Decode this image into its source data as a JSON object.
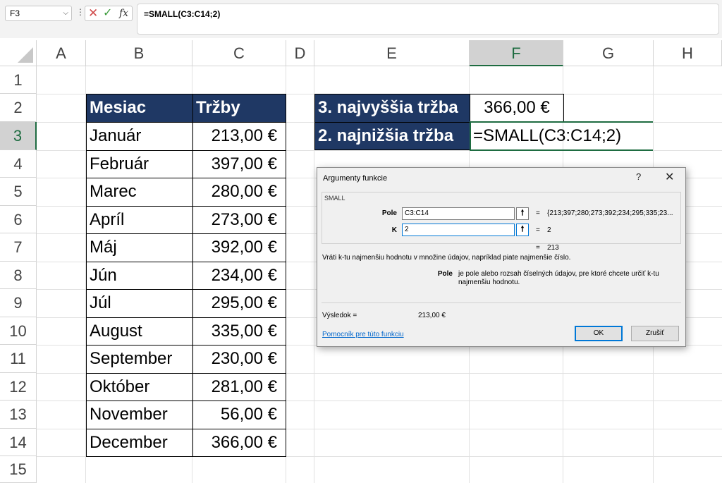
{
  "formula_bar": {
    "name_box": "F3",
    "separator": "⋮",
    "cancel_icon": "✕",
    "enter_icon": "✓",
    "fx_label": "fx",
    "formula": "=SMALL(C3:C14;2)"
  },
  "columns": [
    "A",
    "B",
    "C",
    "D",
    "E",
    "F",
    "G",
    "H"
  ],
  "rows": [
    "1",
    "2",
    "3",
    "4",
    "5",
    "6",
    "7",
    "8",
    "9",
    "10",
    "11",
    "12",
    "13",
    "14",
    "15"
  ],
  "table": {
    "header": [
      "Mesiac",
      "Tržby"
    ],
    "rows": [
      [
        "Január",
        "213,00 €"
      ],
      [
        "Február",
        "397,00 €"
      ],
      [
        "Marec",
        "280,00 €"
      ],
      [
        "Apríl",
        "273,00 €"
      ],
      [
        "Máj",
        "392,00 €"
      ],
      [
        "Jún",
        "234,00 €"
      ],
      [
        "Júl",
        "295,00 €"
      ],
      [
        "August",
        "335,00 €"
      ],
      [
        "September",
        "230,00 €"
      ],
      [
        "Október",
        "281,00 €"
      ],
      [
        "November",
        "56,00 €"
      ],
      [
        "December",
        "366,00 €"
      ]
    ]
  },
  "summary": {
    "label1": "3. najvyššia tržba",
    "value1": "366,00 €",
    "label2": "2. najnižšia tržba",
    "value2": "=SMALL(C3:C14;2)"
  },
  "dialog": {
    "title": "Argumenty funkcie",
    "help": "?",
    "close": "✕",
    "function_name": "SMALL",
    "args": [
      {
        "label": "Pole",
        "value": "C3:C14",
        "result": "{213;397;280;273;392;234;295;335;23..."
      },
      {
        "label": "K",
        "value": "2",
        "result": "2"
      }
    ],
    "eq": "=",
    "overall_result": "213",
    "description": "Vráti k-tu najmenšiu hodnotu v množine údajov, napríklad piate najmenšie číslo.",
    "param_name": "Pole",
    "param_desc": "je pole alebo rozsah číselných údajov, pre ktoré chcete určiť k-tu najmenšiu hodnotu.",
    "result_label": "Výsledok =",
    "result_value": "213,00 €",
    "help_link": "Pomocník pre túto funkciu",
    "ok": "OK",
    "cancel": "Zrušiť"
  },
  "colors": {
    "header_fill": "#1f3864",
    "selection": "#1e6c41"
  }
}
